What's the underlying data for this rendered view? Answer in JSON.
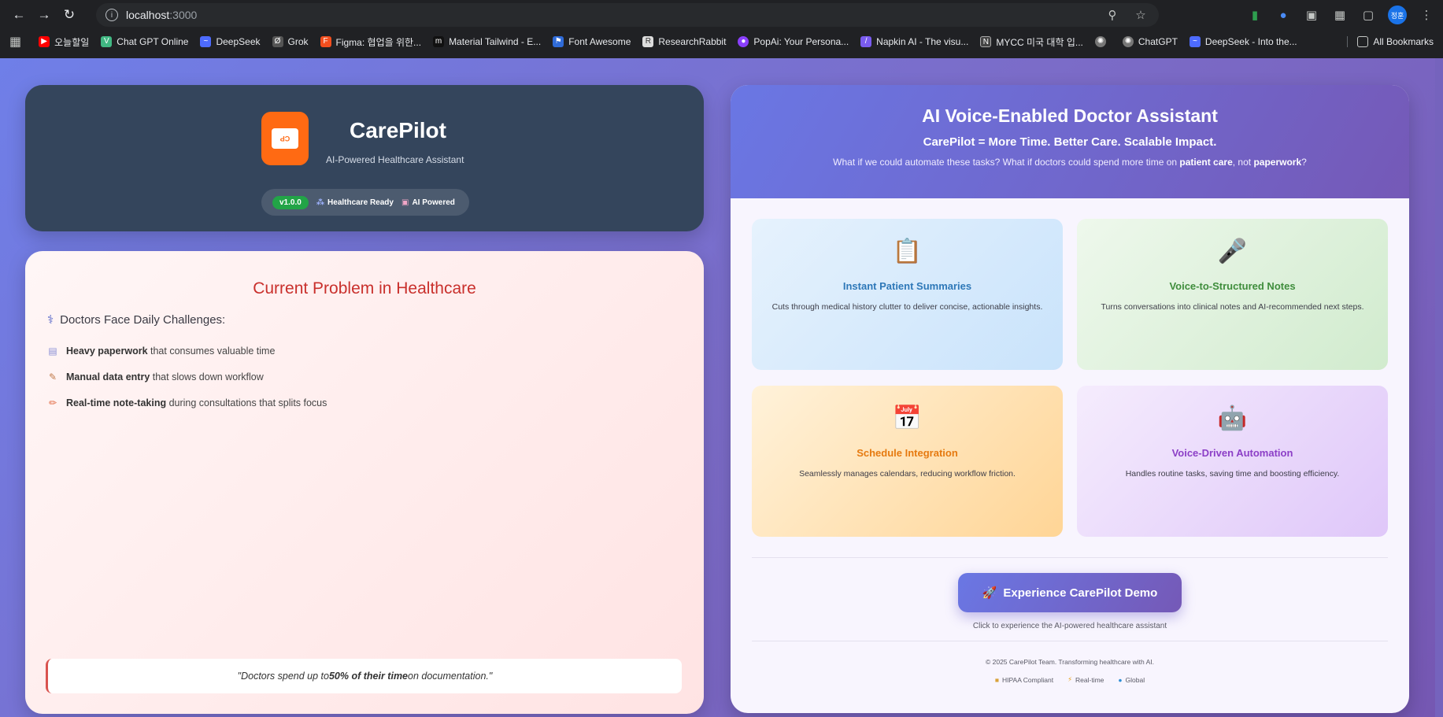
{
  "browser": {
    "url_host": "localhost",
    "url_port": ":3000",
    "profile_initials": "정훈",
    "bookmarks": [
      {
        "label": "오늘할일",
        "icon": "youtube-icon",
        "color": "#ff0000"
      },
      {
        "label": "Chat GPT Online",
        "icon": "vue-icon",
        "color": "#41b883"
      },
      {
        "label": "DeepSeek",
        "icon": "deepseek-icon",
        "color": "#4d6bfe"
      },
      {
        "label": "Grok",
        "icon": "grok-icon",
        "color": "#555555"
      },
      {
        "label": "Figma: 협업을 위한...",
        "icon": "figma-icon",
        "color": "#f24e1e"
      },
      {
        "label": "Material Tailwind - E...",
        "icon": "material-icon",
        "color": "#111111"
      },
      {
        "label": "Font Awesome",
        "icon": "flag-icon",
        "color": "#2f6bd8"
      },
      {
        "label": "ResearchRabbit",
        "icon": "rabbit-icon",
        "color": "#dddddd"
      },
      {
        "label": "PopAi: Your Persona...",
        "icon": "popai-icon",
        "color": "#8a3ffc"
      },
      {
        "label": "Napkin AI - The visu...",
        "icon": "napkin-icon",
        "color": "#7a5cf0"
      },
      {
        "label": "MYCC 미국 대학 입...",
        "icon": "mycc-icon",
        "color": "#444444"
      },
      {
        "label": "",
        "icon": "chatgpt-icon",
        "color": "#777777"
      },
      {
        "label": "ChatGPT",
        "icon": "chatgpt-icon",
        "color": "#777777"
      },
      {
        "label": "DeepSeek - Into the...",
        "icon": "deepseek-icon",
        "color": "#4d6bfe"
      }
    ],
    "all_bookmarks_label": "All Bookmarks"
  },
  "brand": {
    "logo_text": "Care Pilot",
    "name": "CarePilot",
    "subtitle": "AI-Powered Healthcare Assistant",
    "version": "v1.0.0",
    "badge_healthcare": "Healthcare Ready",
    "badge_ai": "AI Powered"
  },
  "problem": {
    "title": "Current Problem in Healthcare",
    "heading": "Doctors Face Daily Challenges:",
    "items": [
      {
        "bold": "Heavy paperwork",
        "rest": " that consumes valuable time",
        "icon": "document-icon"
      },
      {
        "bold": "Manual data entry",
        "rest": " that slows down workflow",
        "icon": "memo-icon"
      },
      {
        "bold": "Real-time note-taking",
        "rest": " during consultations that splits focus",
        "icon": "pencil-icon"
      }
    ],
    "quote_pre": "\"Doctors spend up to ",
    "quote_bold": "50% of their time",
    "quote_post": " on documentation.\""
  },
  "assistant": {
    "title": "AI Voice-Enabled Doctor Assistant",
    "tagline": "CarePilot = More Time. Better Care. Scalable Impact.",
    "question_pre": "What if we could automate these tasks? What if doctors could spend more time on ",
    "question_b1": "patient care",
    "question_mid": ", not ",
    "question_b2": "paperwork",
    "question_post": "?",
    "features": [
      {
        "title": "Instant Patient Summaries",
        "desc": "Cuts through medical history clutter to deliver concise, actionable insights.",
        "icon": "clipboard-icon"
      },
      {
        "title": "Voice-to-Structured Notes",
        "desc": "Turns conversations into clinical notes and AI-recommended next steps.",
        "icon": "microphone-icon"
      },
      {
        "title": "Schedule Integration",
        "desc": "Seamlessly manages calendars, reducing workflow friction.",
        "icon": "calendar-icon"
      },
      {
        "title": "Voice-Driven Automation",
        "desc": "Handles routine tasks, saving time and boosting efficiency.",
        "icon": "robot-icon"
      }
    ],
    "demo_button": "Experience CarePilot Demo",
    "demo_hint": "Click to experience the AI-powered healthcare assistant",
    "copyright": "© 2025 CarePilot Team. Transforming healthcare with AI.",
    "footer_badges": [
      "HIPAA Compliant",
      "Real-time",
      "Global"
    ]
  }
}
